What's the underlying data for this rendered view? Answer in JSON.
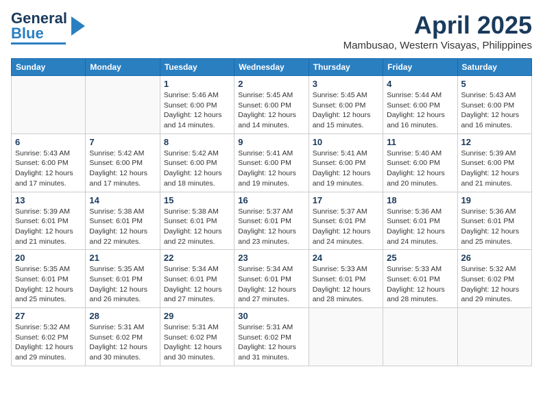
{
  "header": {
    "logo_line1": "General",
    "logo_line2": "Blue",
    "title": "April 2025",
    "subtitle": "Mambusao, Western Visayas, Philippines"
  },
  "weekdays": [
    "Sunday",
    "Monday",
    "Tuesday",
    "Wednesday",
    "Thursday",
    "Friday",
    "Saturday"
  ],
  "weeks": [
    [
      {
        "day": "",
        "detail": ""
      },
      {
        "day": "",
        "detail": ""
      },
      {
        "day": "1",
        "detail": "Sunrise: 5:46 AM\nSunset: 6:00 PM\nDaylight: 12 hours and 14 minutes."
      },
      {
        "day": "2",
        "detail": "Sunrise: 5:45 AM\nSunset: 6:00 PM\nDaylight: 12 hours and 14 minutes."
      },
      {
        "day": "3",
        "detail": "Sunrise: 5:45 AM\nSunset: 6:00 PM\nDaylight: 12 hours and 15 minutes."
      },
      {
        "day": "4",
        "detail": "Sunrise: 5:44 AM\nSunset: 6:00 PM\nDaylight: 12 hours and 16 minutes."
      },
      {
        "day": "5",
        "detail": "Sunrise: 5:43 AM\nSunset: 6:00 PM\nDaylight: 12 hours and 16 minutes."
      }
    ],
    [
      {
        "day": "6",
        "detail": "Sunrise: 5:43 AM\nSunset: 6:00 PM\nDaylight: 12 hours and 17 minutes."
      },
      {
        "day": "7",
        "detail": "Sunrise: 5:42 AM\nSunset: 6:00 PM\nDaylight: 12 hours and 17 minutes."
      },
      {
        "day": "8",
        "detail": "Sunrise: 5:42 AM\nSunset: 6:00 PM\nDaylight: 12 hours and 18 minutes."
      },
      {
        "day": "9",
        "detail": "Sunrise: 5:41 AM\nSunset: 6:00 PM\nDaylight: 12 hours and 19 minutes."
      },
      {
        "day": "10",
        "detail": "Sunrise: 5:41 AM\nSunset: 6:00 PM\nDaylight: 12 hours and 19 minutes."
      },
      {
        "day": "11",
        "detail": "Sunrise: 5:40 AM\nSunset: 6:00 PM\nDaylight: 12 hours and 20 minutes."
      },
      {
        "day": "12",
        "detail": "Sunrise: 5:39 AM\nSunset: 6:00 PM\nDaylight: 12 hours and 21 minutes."
      }
    ],
    [
      {
        "day": "13",
        "detail": "Sunrise: 5:39 AM\nSunset: 6:01 PM\nDaylight: 12 hours and 21 minutes."
      },
      {
        "day": "14",
        "detail": "Sunrise: 5:38 AM\nSunset: 6:01 PM\nDaylight: 12 hours and 22 minutes."
      },
      {
        "day": "15",
        "detail": "Sunrise: 5:38 AM\nSunset: 6:01 PM\nDaylight: 12 hours and 22 minutes."
      },
      {
        "day": "16",
        "detail": "Sunrise: 5:37 AM\nSunset: 6:01 PM\nDaylight: 12 hours and 23 minutes."
      },
      {
        "day": "17",
        "detail": "Sunrise: 5:37 AM\nSunset: 6:01 PM\nDaylight: 12 hours and 24 minutes."
      },
      {
        "day": "18",
        "detail": "Sunrise: 5:36 AM\nSunset: 6:01 PM\nDaylight: 12 hours and 24 minutes."
      },
      {
        "day": "19",
        "detail": "Sunrise: 5:36 AM\nSunset: 6:01 PM\nDaylight: 12 hours and 25 minutes."
      }
    ],
    [
      {
        "day": "20",
        "detail": "Sunrise: 5:35 AM\nSunset: 6:01 PM\nDaylight: 12 hours and 25 minutes."
      },
      {
        "day": "21",
        "detail": "Sunrise: 5:35 AM\nSunset: 6:01 PM\nDaylight: 12 hours and 26 minutes."
      },
      {
        "day": "22",
        "detail": "Sunrise: 5:34 AM\nSunset: 6:01 PM\nDaylight: 12 hours and 27 minutes."
      },
      {
        "day": "23",
        "detail": "Sunrise: 5:34 AM\nSunset: 6:01 PM\nDaylight: 12 hours and 27 minutes."
      },
      {
        "day": "24",
        "detail": "Sunrise: 5:33 AM\nSunset: 6:01 PM\nDaylight: 12 hours and 28 minutes."
      },
      {
        "day": "25",
        "detail": "Sunrise: 5:33 AM\nSunset: 6:01 PM\nDaylight: 12 hours and 28 minutes."
      },
      {
        "day": "26",
        "detail": "Sunrise: 5:32 AM\nSunset: 6:02 PM\nDaylight: 12 hours and 29 minutes."
      }
    ],
    [
      {
        "day": "27",
        "detail": "Sunrise: 5:32 AM\nSunset: 6:02 PM\nDaylight: 12 hours and 29 minutes."
      },
      {
        "day": "28",
        "detail": "Sunrise: 5:31 AM\nSunset: 6:02 PM\nDaylight: 12 hours and 30 minutes."
      },
      {
        "day": "29",
        "detail": "Sunrise: 5:31 AM\nSunset: 6:02 PM\nDaylight: 12 hours and 30 minutes."
      },
      {
        "day": "30",
        "detail": "Sunrise: 5:31 AM\nSunset: 6:02 PM\nDaylight: 12 hours and 31 minutes."
      },
      {
        "day": "",
        "detail": ""
      },
      {
        "day": "",
        "detail": ""
      },
      {
        "day": "",
        "detail": ""
      }
    ]
  ]
}
